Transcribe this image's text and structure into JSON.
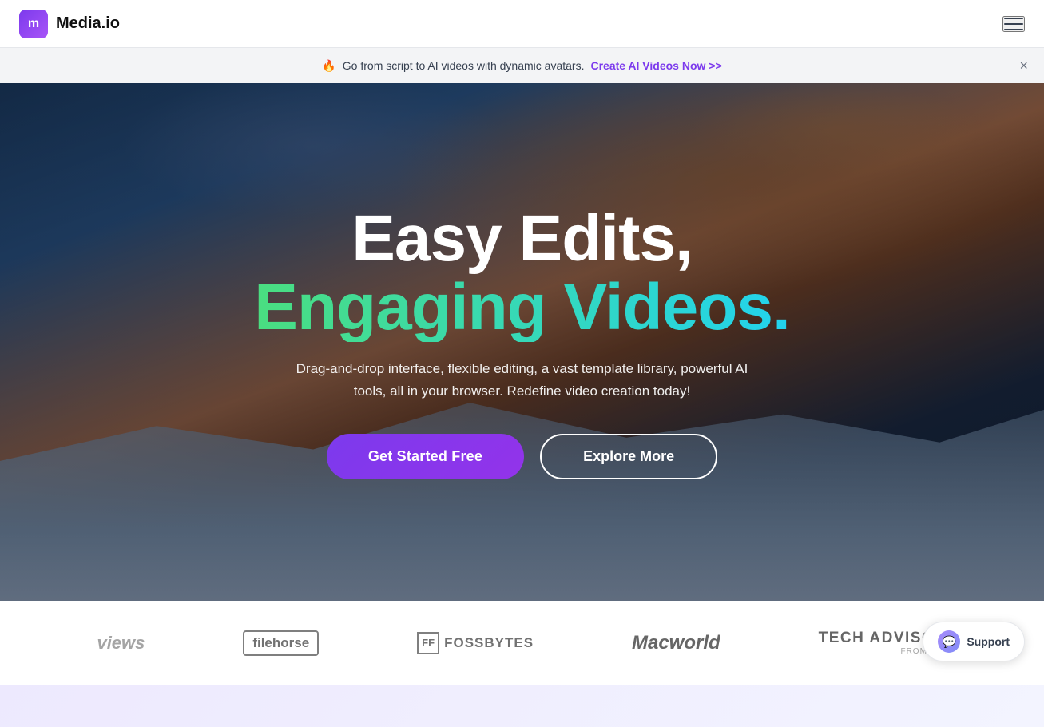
{
  "navbar": {
    "logo_letter": "m",
    "logo_name": "Media.io",
    "menu_icon_label": "menu"
  },
  "banner": {
    "fire_emoji": "🔥",
    "text": "Go from script to AI videos with dynamic avatars.",
    "link_text": "Create AI Videos Now >>",
    "close_label": "×"
  },
  "hero": {
    "title_line1": "Easy Edits,",
    "title_line2": "Engaging Videos.",
    "subtitle": "Drag-and-drop interface, flexible editing, a vast template library, powerful AI tools, all in your browser. Redefine video creation today!",
    "btn_primary": "Get Started Free",
    "btn_secondary": "Explore More"
  },
  "logos": {
    "items": [
      {
        "id": "views",
        "label": "views",
        "type": "views"
      },
      {
        "id": "filehorse",
        "label": "filehorse",
        "type": "filehorse"
      },
      {
        "id": "fossbytes",
        "label": "FOSSBYTES",
        "type": "fossbytes",
        "icon": "FF"
      },
      {
        "id": "macworld",
        "label": "Macworld",
        "type": "macworld"
      },
      {
        "id": "techadviser",
        "label": "TECH ADVISOR",
        "sub": "FROM IDG",
        "type": "techadviser"
      }
    ]
  },
  "support": {
    "label": "Support",
    "icon": "💬"
  }
}
